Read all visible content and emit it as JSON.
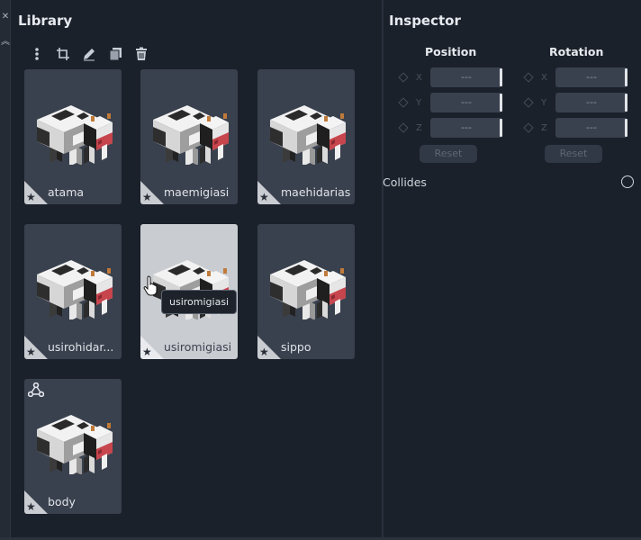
{
  "side_strip": {
    "close_icon": "close-icon",
    "collapse_icon": "chevrons-up-icon"
  },
  "library": {
    "title": "Library",
    "toolbar": [
      "more-vertical-icon",
      "crop-icon",
      "pencil-icon",
      "duplicate-icon",
      "trash-icon"
    ],
    "items": [
      {
        "label": "atama"
      },
      {
        "label": "maemigiasi"
      },
      {
        "label": "maehidariasi"
      },
      {
        "label": "usirohidar..."
      },
      {
        "label": "usiromigiasi"
      },
      {
        "label": "sippo"
      },
      {
        "label": "body"
      }
    ],
    "hovered_item": "usiromigiasi",
    "tooltip": "usiromigiasi"
  },
  "inspector": {
    "title": "Inspector",
    "position": {
      "heading": "Position",
      "axes": [
        {
          "axis": "X",
          "value": "---"
        },
        {
          "axis": "Y",
          "value": "---"
        },
        {
          "axis": "Z",
          "value": "---"
        }
      ],
      "reset_label": "Reset"
    },
    "rotation": {
      "heading": "Rotation",
      "axes": [
        {
          "axis": "X",
          "value": "---"
        },
        {
          "axis": "Y",
          "value": "---"
        },
        {
          "axis": "Z",
          "value": "---"
        }
      ],
      "reset_label": "Reset"
    },
    "collides_label": "Collides",
    "collides_checked": false
  },
  "colors": {
    "background": "#1b212b",
    "card": "#3a414e",
    "card_hover": "#c9ccd1",
    "text": "#e6e9ee"
  }
}
